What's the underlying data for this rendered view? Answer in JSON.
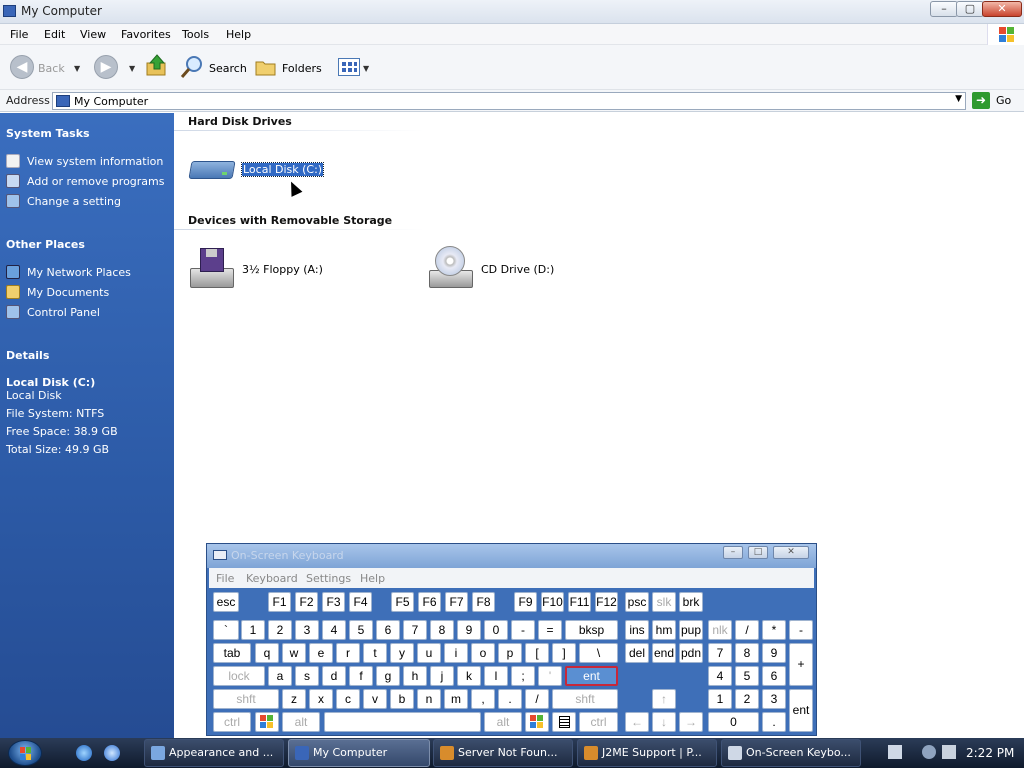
{
  "window": {
    "title": "My Computer",
    "controls": {
      "minimize": "–",
      "maximize": "▢",
      "close": "✕"
    }
  },
  "menu": [
    "File",
    "Edit",
    "View",
    "Favorites",
    "Tools",
    "Help"
  ],
  "toolbar": {
    "back": "Back",
    "search": "Search",
    "folders": "Folders"
  },
  "address": {
    "label": "Address",
    "value": "My Computer",
    "go": "Go"
  },
  "taskpane": {
    "system_tasks": {
      "title": "System Tasks",
      "items": [
        "View system information",
        "Add or remove programs",
        "Change a setting"
      ]
    },
    "other_places": {
      "title": "Other Places",
      "items": [
        "My Network Places",
        "My Documents",
        "Control Panel"
      ]
    },
    "details": {
      "title": "Details",
      "name": "Local Disk (C:)",
      "type": "Local Disk",
      "file_system": "File System: NTFS",
      "free_space": "Free Space: 38.9 GB",
      "total_size": "Total Size: 49.9 GB"
    }
  },
  "content": {
    "hard_disk_heading": "Hard Disk Drives",
    "local_disk": "Local Disk (C:)",
    "removable_heading": "Devices with Removable Storage",
    "floppy": "3½ Floppy (A:)",
    "cd": "CD Drive (D:)"
  },
  "osk": {
    "title": "On-Screen Keyboard",
    "menu": [
      "File",
      "Keyboard",
      "Settings",
      "Help"
    ],
    "keys": {
      "row0": [
        "esc",
        "F1",
        "F2",
        "F3",
        "F4",
        "F5",
        "F6",
        "F7",
        "F8",
        "F9",
        "F10",
        "F11",
        "F12",
        "psc",
        "slk",
        "brk"
      ],
      "row1": [
        "`",
        "1",
        "2",
        "3",
        "4",
        "5",
        "6",
        "7",
        "8",
        "9",
        "0",
        "-",
        "=",
        "bksp",
        "ins",
        "hm",
        "pup",
        "nlk",
        "/",
        "*",
        "-"
      ],
      "row2": [
        "tab",
        "q",
        "w",
        "e",
        "r",
        "t",
        "y",
        "u",
        "i",
        "o",
        "p",
        "[",
        "]",
        "\\",
        "del",
        "end",
        "pdn",
        "7",
        "8",
        "9",
        "+"
      ],
      "row3": [
        "lock",
        "a",
        "s",
        "d",
        "f",
        "g",
        "h",
        "j",
        "k",
        "l",
        ";",
        "'",
        "ent",
        "4",
        "5",
        "6"
      ],
      "row4": [
        "shft",
        "z",
        "x",
        "c",
        "v",
        "b",
        "n",
        "m",
        ",",
        ".",
        "/",
        "shft",
        "↑",
        "1",
        "2",
        "3",
        "ent"
      ],
      "row5": [
        "ctrl",
        "alt",
        "alt",
        "ctrl",
        "←",
        "↓",
        "→",
        "0",
        "."
      ]
    }
  },
  "taskbar": {
    "buttons": [
      "Appearance and ...",
      "My Computer",
      "Server Not Foun...",
      "J2ME Support | P...",
      "On-Screen Keybo..."
    ],
    "clock": "2:22 PM"
  }
}
